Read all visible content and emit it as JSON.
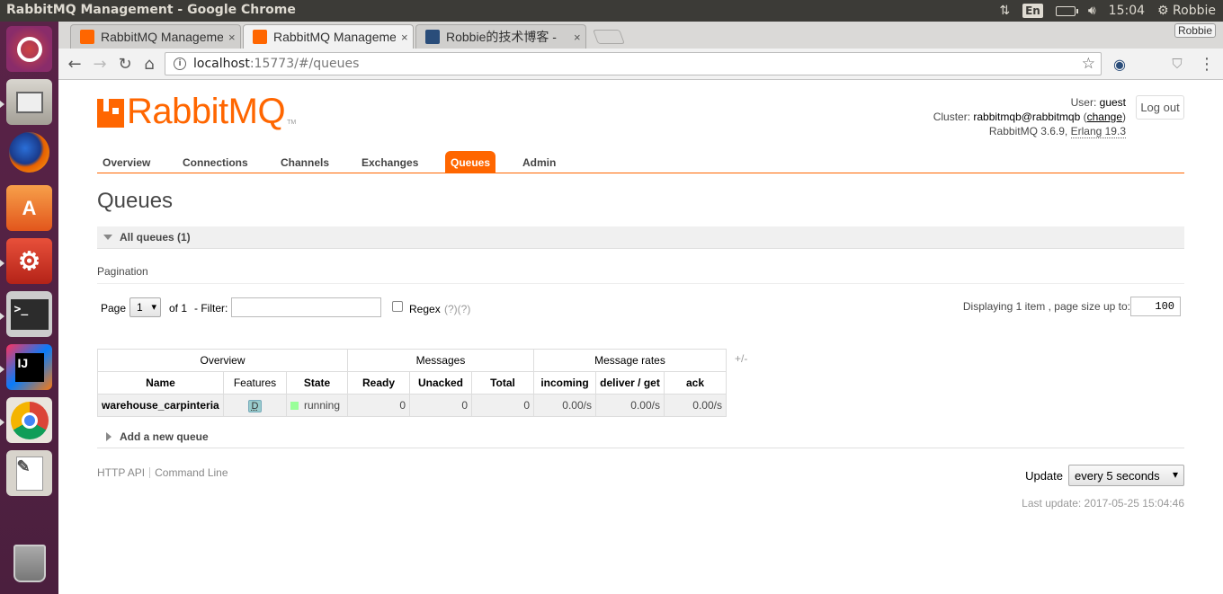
{
  "os": {
    "window_title": "RabbitMQ Management - Google Chrome",
    "keyboard_lang": "En",
    "clock": "15:04",
    "user": "Robbie",
    "launcher_items": [
      "ubuntu-dash",
      "files",
      "firefox",
      "software-center",
      "system-settings",
      "terminal",
      "intellij-idea",
      "chrome",
      "text-editor",
      "trash"
    ]
  },
  "browser": {
    "tabs": [
      {
        "label": "RabbitMQ Management",
        "active": false,
        "close": "×"
      },
      {
        "label": "RabbitMQ Management",
        "active": true,
        "close": "×"
      },
      {
        "label": "Robbie的技术博客 -",
        "active": false,
        "close": "×"
      }
    ],
    "profile_label": "Robbie",
    "url_host": "localhost",
    "url_rest": ":15773/#/queues"
  },
  "header": {
    "logo_text": "RabbitMQ",
    "logo_tm": "TM",
    "user_label": "User:",
    "user_value": "guest",
    "cluster_label": "Cluster:",
    "cluster_value": "rabbitmqb@rabbitmqb",
    "cluster_change": "change",
    "version_text": "RabbitMQ 3.6.9,",
    "erlang_text": "Erlang 19.3",
    "logout_label": "Log out"
  },
  "nav": {
    "items": [
      "Overview",
      "Connections",
      "Channels",
      "Exchanges",
      "Queues",
      "Admin"
    ],
    "active": "Queues"
  },
  "page": {
    "title": "Queues",
    "all_queues_label": "All queues (1)",
    "pagination_label": "Pagination",
    "page_label": "Page",
    "page_value": "1",
    "of_label": "of 1",
    "filter_label": "- Filter:",
    "filter_value": "",
    "regex_label": "Regex",
    "regex_help": "(?)(?)",
    "display_label": "Displaying 1 item , page size up to:",
    "page_size": "100",
    "plus_minus": "+/-",
    "add_queue_label": "Add a new queue"
  },
  "table": {
    "groups": [
      "Overview",
      "Messages",
      "Message rates"
    ],
    "columns": [
      "Name",
      "Features",
      "State",
      "Ready",
      "Unacked",
      "Total",
      "incoming",
      "deliver / get",
      "ack"
    ],
    "rows": [
      {
        "name": "warehouse_carpinteria",
        "features": "D",
        "state": "running",
        "ready": "0",
        "unacked": "0",
        "total": "0",
        "incoming": "0.00/s",
        "deliver_get": "0.00/s",
        "ack": "0.00/s"
      }
    ]
  },
  "footer": {
    "http_api": "HTTP API",
    "command_line": "Command Line",
    "update_label": "Update",
    "update_value": "every 5 seconds",
    "last_update": "Last update: 2017-05-25 15:04:46"
  },
  "colors": {
    "brand": "#ff6600",
    "launcher": "#5a2348",
    "panel": "#3c3b37"
  }
}
